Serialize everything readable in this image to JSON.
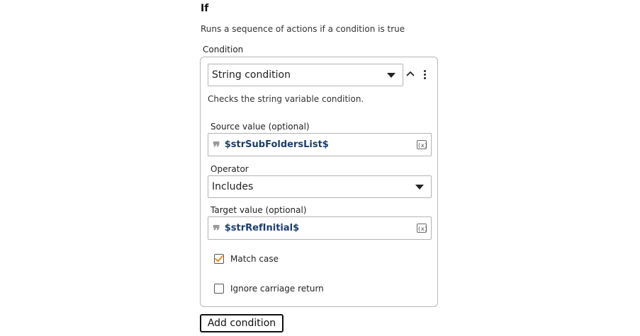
{
  "action": {
    "title": "If",
    "description": "Runs a sequence of actions if a condition is true"
  },
  "condition": {
    "section_label": "Condition",
    "type_select": {
      "value": "String condition"
    },
    "description": "Checks the string variable condition.",
    "source": {
      "label": "Source value (optional)",
      "value": "$strSubFoldersList$",
      "variable_button": "(x)"
    },
    "operator": {
      "label": "Operator",
      "value": "Includes"
    },
    "target": {
      "label": "Target value (optional)",
      "value": "$strRefInitial$",
      "variable_button": "(x)"
    },
    "options": [
      {
        "label": "Match case",
        "checked": true
      },
      {
        "label": "Ignore carriage return",
        "checked": false
      }
    ]
  },
  "add_condition_label": "Add condition",
  "colors": {
    "accent_check": "#f08a1c",
    "variable_text": "#1b3d6e",
    "border": "#b3b3b3"
  },
  "icons": {
    "dropdown": "caret-down-icon",
    "collapse": "chevron-up-icon",
    "more": "kebab-menu-icon",
    "string": "quote-icon",
    "variable": "variable-icon",
    "check": "checkmark-icon"
  }
}
